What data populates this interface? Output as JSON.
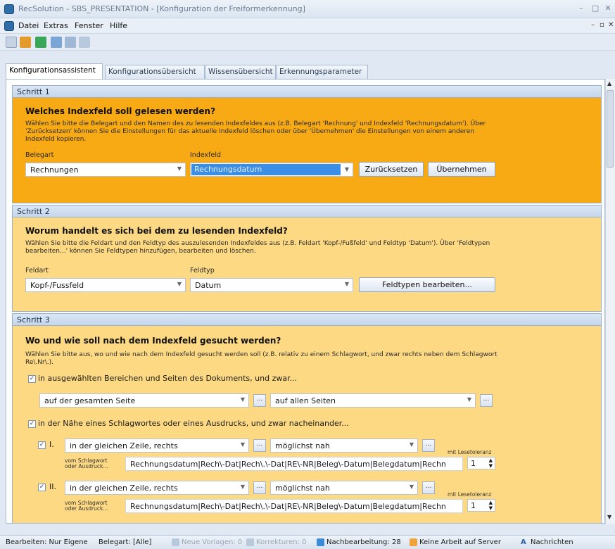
{
  "window": {
    "title": "RecSolution - SBS_PRESENTATION - [Konfiguration der Freiformerkennung]"
  },
  "menu": {
    "items": [
      "Datei",
      "Extras",
      "Fenster",
      "Hilfe"
    ]
  },
  "tabs": [
    "Konfigurationsassistent",
    "Konfigurationsübersicht",
    "Wissensübersicht",
    "Erkennungsparameter"
  ],
  "step1": {
    "header": "Schritt 1",
    "question": "Welches Indexfeld soll gelesen werden?",
    "description": "Wählen Sie bitte die Belegart und den Namen des zu lesenden Indexfeldes aus (z.B. Belegart 'Rechnung' und Indexfeld 'Rechnungsdatum'). Über 'Zurücksetzen' können Sie die Einstellungen für das aktuelle Indexfeld löschen oder über 'Übernehmen' die Einstellungen von einem anderen Indexfeld kopieren.",
    "belegart_label": "Belegart",
    "belegart_value": "Rechnungen",
    "indexfeld_label": "Indexfeld",
    "indexfeld_value": "Rechnungsdatum",
    "reset_label": "Zurücksetzen",
    "apply_label": "Übernehmen"
  },
  "step2": {
    "header": "Schritt 2",
    "question": "Worum handelt es sich bei dem zu lesenden Indexfeld?",
    "description": "Wählen Sie bitte die Feldart und den Feldtyp des auszulesenden Indexfeldes aus (z.B. Feldart 'Kopf-/Fußfeld' und Feldtyp 'Datum'). Über 'Feldtypen bearbeiten...' können Sie Feldtypen hinzufügen, bearbeiten und löschen.",
    "feldart_label": "Feldart",
    "feldart_value": "Kopf-/Fussfeld",
    "feldtyp_label": "Feldtyp",
    "feldtyp_value": "Datum",
    "edit_label": "Feldtypen bearbeiten..."
  },
  "step3": {
    "header": "Schritt 3",
    "question": "Wo und wie soll nach dem Indexfeld gesucht werden?",
    "description": "Wählen Sie bitte aus, wo und wie nach dem Indexfeld gesucht werden soll (z.B. relativ zu einem Schlagwort, und zwar rechts neben dem Schlagwort Re\\.Nr\\.).",
    "check1": "in ausgewählten Bereichen und Seiten des Dokuments, und zwar...",
    "area_value": "auf der gesamten Seite",
    "pages_value": "auf allen Seiten",
    "check2": "in der Nähe eines Schlagwortes oder eines Ausdrucks, und zwar nacheinander...",
    "rows": [
      {
        "num": "I.",
        "pos": "in der gleichen Zeile, rechts",
        "dist": "möglichst nah",
        "tol_label": "mit Lesetoleranz",
        "kw_label": "vom Schlagwort oder Ausdruck...",
        "kw_value": "Rechnungsdatum|Rech\\-Dat|Rech\\.\\-Dat|RE\\-NR|Beleg\\-Datum|Belegdatum|Rechn",
        "tol_value": "1"
      },
      {
        "num": "II.",
        "pos": "in der gleichen Zeile, rechts",
        "dist": "möglichst nah",
        "tol_label": "mit Lesetoleranz",
        "kw_label": "vom Schlagwort oder Ausdruck...",
        "kw_value": "Rechnungsdatum|Rech\\-Dat|Rech\\.\\-Dat|RE\\-NR|Beleg\\-Datum|Belegdatum|Rechn",
        "tol_value": "1"
      }
    ]
  },
  "status": {
    "edit": "Bearbeiten: Nur Eigene",
    "belegart": "Belegart: [Alle]",
    "templates": "Neue Vorlagen: 0",
    "corrections": "Korrekturen: 0",
    "postedit": "Nachbearbeitung: 28",
    "server": "Keine Arbeit auf Server",
    "messages": "Nachrichten"
  },
  "colors": {
    "step_active": "#f7aa14",
    "step_inactive": "#fdd983",
    "selection": "#3a8ee6"
  }
}
